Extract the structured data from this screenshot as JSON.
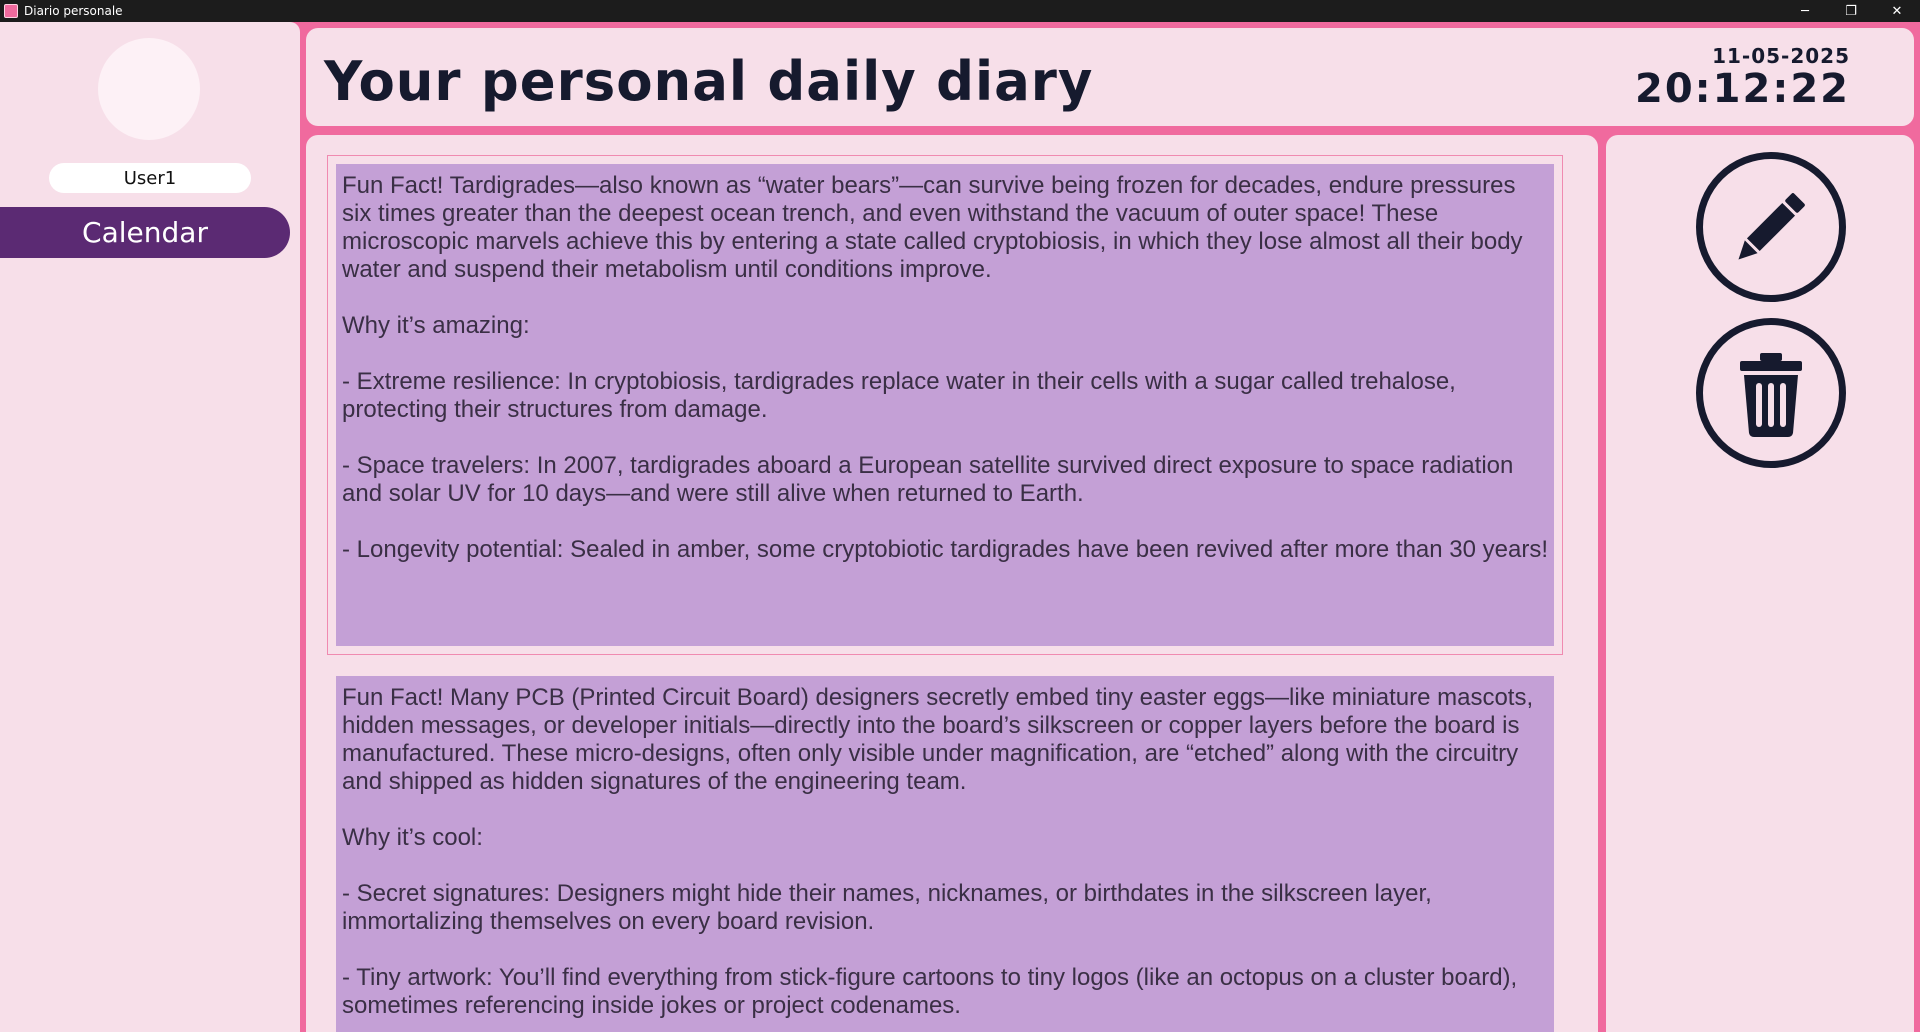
{
  "window": {
    "title": "Diario personale",
    "controls": {
      "minimize": "─",
      "maximize": "❐",
      "close": "✕"
    }
  },
  "sidebar": {
    "username": "User1",
    "nav": {
      "calendar_label": "Calendar"
    }
  },
  "header": {
    "title": "Your personal daily diary",
    "date": "11-05-2025",
    "time": "20:12:22"
  },
  "entries": [
    {
      "text": "Fun Fact! Tardigrades—also known as “water bears”—can survive being frozen for decades, endure pressures six times greater than the deepest ocean trench, and even withstand the vacuum of outer space! These microscopic marvels achieve this by entering a state called cryptobiosis, in which they lose almost all their body water and suspend their metabolism until conditions improve.\n\nWhy it’s amazing:\n\n- Extreme resilience: In cryptobiosis, tardigrades replace water in their cells with a sugar called trehalose, protecting their structures from damage.\n\n- Space travelers: In 2007, tardigrades aboard a European satellite survived direct exposure to space radiation and solar UV for 10 days—and were still alive when returned to Earth.\n\n- Longevity potential: Sealed in amber, some cryptobiotic tardigrades have been revived after more than 30 years!",
      "selected": true
    },
    {
      "text": "Fun Fact! Many PCB (Printed Circuit Board) designers secretly embed tiny easter eggs—like miniature mascots, hidden messages, or developer initials—directly into the board’s silkscreen or copper layers before the board is manufactured. These micro-designs, often only visible under magnification, are “etched” along with the circuitry and shipped as hidden signatures of the engineering team.\n\nWhy it’s cool:\n\n- Secret signatures: Designers might hide their names, nicknames, or birthdates in the silkscreen layer, immortalizing themselves on every board revision.\n\n- Tiny artwork: You’ll find everything from stick-figure cartoons to tiny logos (like an octopus on a cluster board), sometimes referencing inside jokes or project codenames.",
      "selected": false
    }
  ],
  "actions": {
    "edit_icon": "pencil-icon",
    "delete_icon": "trash-icon"
  },
  "colors": {
    "accent_pink": "#f06a9e",
    "panel_bg": "#f7dfe9",
    "entry_bg": "#c4a0d6",
    "nav_purple": "#5b2a73",
    "ink": "#161a2e"
  }
}
